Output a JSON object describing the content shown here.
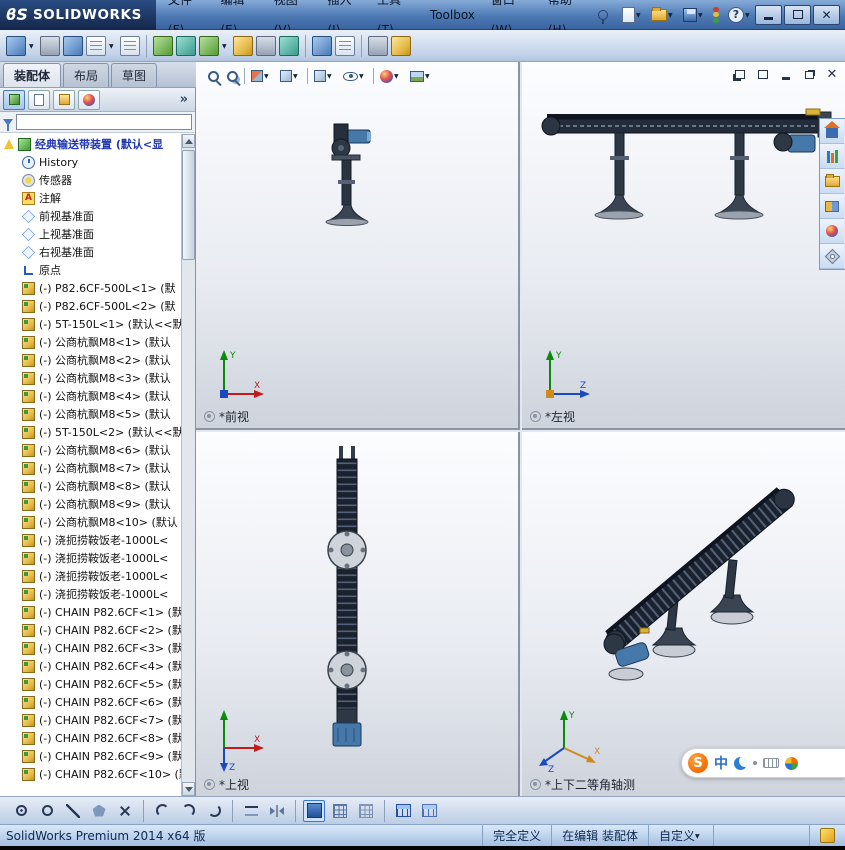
{
  "titlebar": {
    "logo_mark": "ϐS",
    "logo_text": "SOLIDWORKS"
  },
  "menubar": {
    "items": [
      {
        "label": "文件(F)"
      },
      {
        "label": "编辑(E)"
      },
      {
        "label": "视图(V)"
      },
      {
        "label": "插入(I)"
      },
      {
        "label": "工具(T)"
      },
      {
        "label": "Toolbox"
      },
      {
        "label": "窗口(W)"
      },
      {
        "label": "帮助(H)"
      }
    ]
  },
  "panel_tabs": {
    "items": [
      {
        "label": "装配体",
        "cls": "active"
      },
      {
        "label": "布局",
        "cls": ""
      },
      {
        "label": "草图",
        "cls": ""
      }
    ]
  },
  "feature_tree": {
    "root_label": "经典输送带装置 (默认<显",
    "items": [
      {
        "label": "History",
        "icon": "history"
      },
      {
        "label": "传感器",
        "icon": "sensor"
      },
      {
        "label": "注解",
        "icon": "note"
      },
      {
        "label": "前视基准面",
        "icon": "plane"
      },
      {
        "label": "上视基准面",
        "icon": "plane"
      },
      {
        "label": "右视基准面",
        "icon": "plane"
      },
      {
        "label": "原点",
        "icon": "origin"
      },
      {
        "label": "(-) P82.6CF-500L<1> (默",
        "icon": "comp"
      },
      {
        "label": "(-) P82.6CF-500L<2> (默",
        "icon": "comp"
      },
      {
        "label": "(-) 5T-150L<1> (默认<<默",
        "icon": "comp"
      },
      {
        "label": "(-) 公商杭飘M8<1> (默认",
        "icon": "comp"
      },
      {
        "label": "(-) 公商杭飘M8<2> (默认",
        "icon": "comp"
      },
      {
        "label": "(-) 公商杭飘M8<3> (默认",
        "icon": "comp"
      },
      {
        "label": "(-) 公商杭飘M8<4> (默认",
        "icon": "comp"
      },
      {
        "label": "(-) 公商杭飘M8<5> (默认",
        "icon": "comp"
      },
      {
        "label": "(-) 5T-150L<2> (默认<<默",
        "icon": "comp"
      },
      {
        "label": "(-) 公商杭飘M8<6> (默认",
        "icon": "comp"
      },
      {
        "label": "(-) 公商杭飘M8<7> (默认",
        "icon": "comp"
      },
      {
        "label": "(-) 公商杭飘M8<8> (默认",
        "icon": "comp"
      },
      {
        "label": "(-) 公商杭飘M8<9> (默认",
        "icon": "comp"
      },
      {
        "label": "(-) 公商杭飘M8<10> (默认",
        "icon": "comp"
      },
      {
        "label": "(-) 浇扼捞鞍饭老-1000L<",
        "icon": "comp"
      },
      {
        "label": "(-) 浇扼捞鞍饭老-1000L<",
        "icon": "comp"
      },
      {
        "label": "(-) 浇扼捞鞍饭老-1000L<",
        "icon": "comp"
      },
      {
        "label": "(-) 浇扼捞鞍饭老-1000L<",
        "icon": "comp"
      },
      {
        "label": "(-) CHAIN P82.6CF<1> (默",
        "icon": "comp"
      },
      {
        "label": "(-) CHAIN P82.6CF<2> (默",
        "icon": "comp"
      },
      {
        "label": "(-) CHAIN P82.6CF<3> (默",
        "icon": "comp"
      },
      {
        "label": "(-) CHAIN P82.6CF<4> (默",
        "icon": "comp"
      },
      {
        "label": "(-) CHAIN P82.6CF<5> (默",
        "icon": "comp"
      },
      {
        "label": "(-) CHAIN P82.6CF<6> (默",
        "icon": "comp"
      },
      {
        "label": "(-) CHAIN P82.6CF<7> (默",
        "icon": "comp"
      },
      {
        "label": "(-) CHAIN P82.6CF<8> (默",
        "icon": "comp"
      },
      {
        "label": "(-) CHAIN P82.6CF<9> (默",
        "icon": "comp"
      },
      {
        "label": "(-) CHAIN P82.6CF<10> (默",
        "icon": "comp"
      }
    ]
  },
  "viewports": {
    "front": {
      "label": "*前视"
    },
    "left": {
      "label": "*左视"
    },
    "top": {
      "label": "*上视"
    },
    "iso": {
      "label": "*上下二等角轴测"
    }
  },
  "statusbar": {
    "product": "SolidWorks Premium 2014 x64 版",
    "define_state": "完全定义",
    "edit_state": "在编辑 装配体",
    "custom_label": "自定义"
  },
  "ime": {
    "logo": "S",
    "lang": "中"
  }
}
